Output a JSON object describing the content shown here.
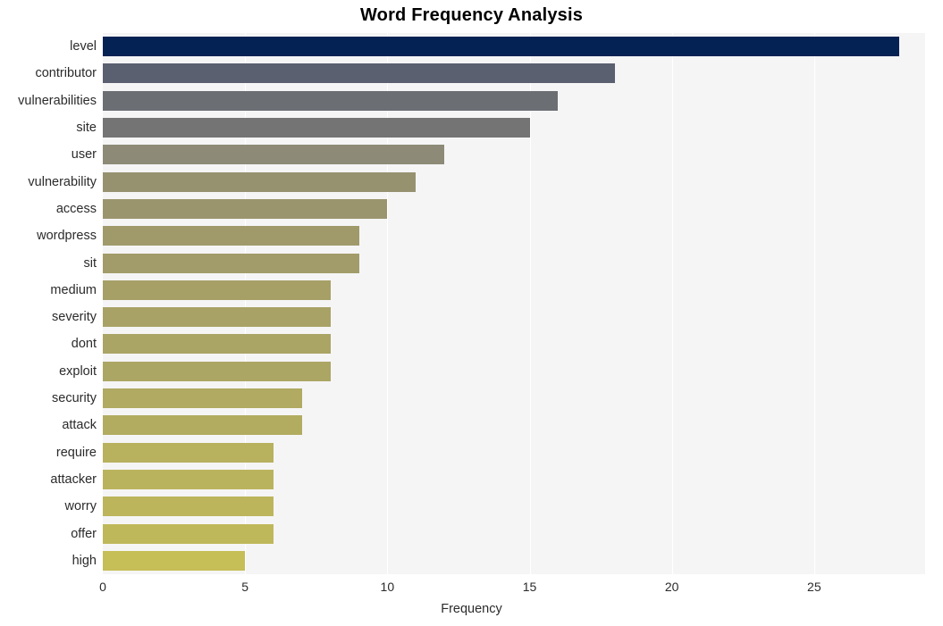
{
  "chart_data": {
    "type": "bar",
    "orientation": "horizontal",
    "title": "Word Frequency Analysis",
    "xlabel": "Frequency",
    "ylabel": "",
    "categories": [
      "level",
      "contributor",
      "vulnerabilities",
      "site",
      "user",
      "vulnerability",
      "access",
      "wordpress",
      "sit",
      "medium",
      "severity",
      "dont",
      "exploit",
      "security",
      "attack",
      "require",
      "attacker",
      "worry",
      "offer",
      "high"
    ],
    "values": [
      28,
      18,
      16,
      15,
      12,
      11,
      10,
      9,
      9,
      8,
      8,
      8,
      8,
      7,
      7,
      6,
      6,
      6,
      6,
      5
    ],
    "bar_colors": [
      "#042254",
      "#5b6070",
      "#6b6e73",
      "#747474",
      "#8d8b77",
      "#969270",
      "#9a956d",
      "#a09a6b",
      "#a29c6a",
      "#a6a067",
      "#a8a266",
      "#aaa465",
      "#aca664",
      "#b0aa62",
      "#b2ac61",
      "#b8b15e",
      "#bab35d",
      "#bcb55c",
      "#bfb85b",
      "#c6be57"
    ],
    "xlim": [
      0,
      28.9
    ],
    "xticks": [
      0,
      5,
      10,
      15,
      20,
      25
    ],
    "xtick_labels": [
      "0",
      "5",
      "10",
      "15",
      "20",
      "25"
    ],
    "grid": "vertical",
    "grid_color": "#ffffff",
    "plot_background": "#f5f5f6",
    "figure_background": "#ffffff",
    "legend": null
  }
}
